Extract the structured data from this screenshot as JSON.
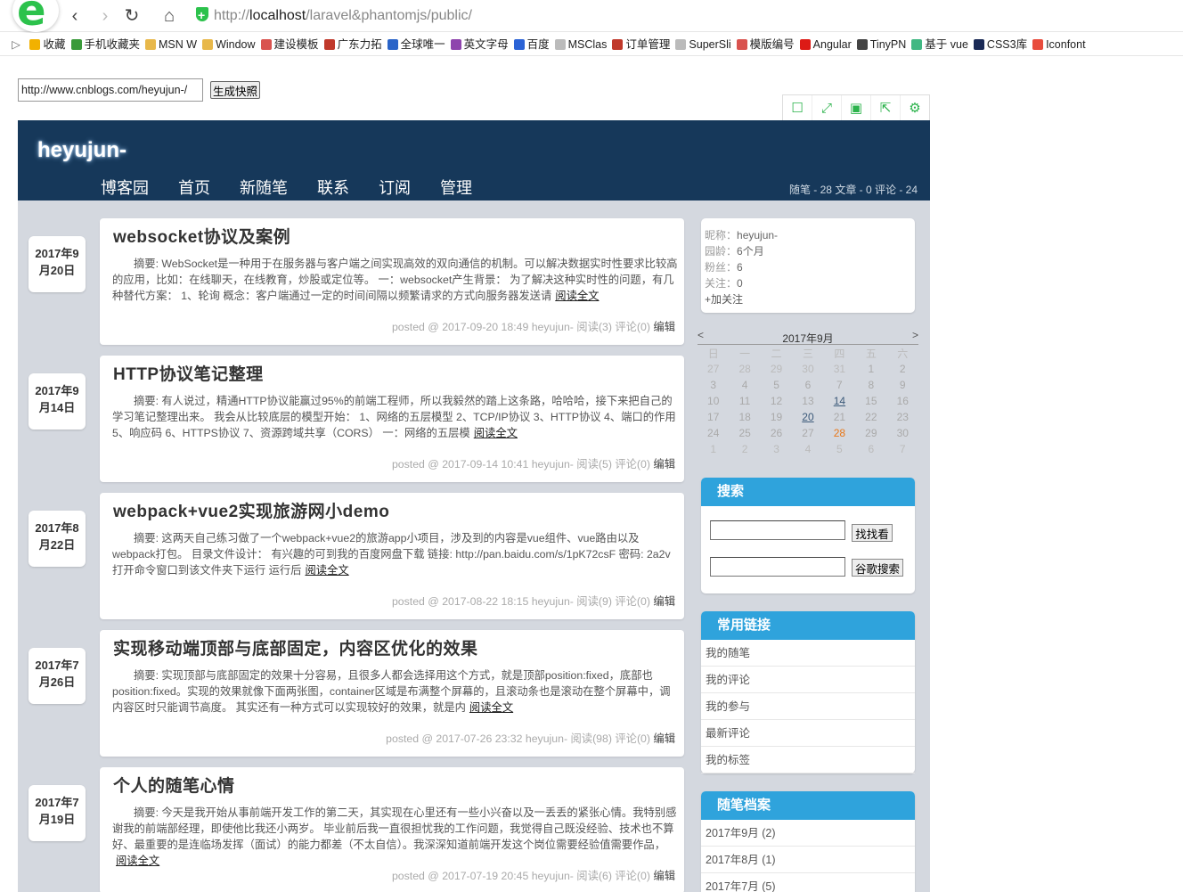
{
  "browser": {
    "brand_glyph": "e",
    "url_scheme": "http://",
    "url_host": "localhost",
    "url_path": "/laravel&phantomjs/public/",
    "favorites": [
      {
        "label": "收藏",
        "color": "#f2b100"
      },
      {
        "label": "手机收藏夹",
        "color": "#3a9a3a"
      },
      {
        "label": "MSN W",
        "color": "#e8b84a"
      },
      {
        "label": "Window",
        "color": "#e8b84a"
      },
      {
        "label": "建设模板",
        "color": "#d9534f"
      },
      {
        "label": "广东力拓",
        "color": "#c0392b"
      },
      {
        "label": "全球唯一",
        "color": "#2a64c8"
      },
      {
        "label": "英文字母",
        "color": "#8e44ad"
      },
      {
        "label": "百度",
        "color": "#2b63d6"
      },
      {
        "label": "MSClas",
        "color": "#bbbbbb"
      },
      {
        "label": "订单管理",
        "color": "#c0392b"
      },
      {
        "label": "SuperSli",
        "color": "#bbbbbb"
      },
      {
        "label": "模版编号",
        "color": "#d9534f"
      },
      {
        "label": "Angular",
        "color": "#dd1b16"
      },
      {
        "label": "TinyPN",
        "color": "#444444"
      },
      {
        "label": "基于 vue",
        "color": "#41b883"
      },
      {
        "label": "CSS3库",
        "color": "#1a2a56"
      },
      {
        "label": "Iconfont",
        "color": "#e84c3d"
      }
    ]
  },
  "snapshot": {
    "url_value": "http://www.cnblogs.com/heyujun-/",
    "button_label": "生成快照"
  },
  "blog": {
    "title": "heyujun-",
    "nav": [
      "博客园",
      "首页",
      "新随笔",
      "联系",
      "订阅",
      "管理"
    ],
    "stats": "随笔 - 28  文章 - 0  评论 - 24"
  },
  "posts": [
    {
      "date1": "2017年9",
      "date2": "月20日",
      "title": "websocket协议及案例",
      "summary": "摘要: WebSocket是一种用于在服务器与客户端之间实现高效的双向通信的机制。可以解决数据实时性要求比较高的应用，比如：在线聊天，在线教育，炒股或定位等。 一：websocket产生背景： 为了解决这种实时性的问题，有几种替代方案： 1、轮询 概念：客户端通过一定的时间间隔以频繁请求的方式向服务器发送请",
      "more": "阅读全文",
      "foot": "posted @ 2017-09-20 18:49 heyujun- 阅读(3) 评论(0) ",
      "edit": "编辑"
    },
    {
      "date1": "2017年9",
      "date2": "月14日",
      "title": "HTTP协议笔记整理",
      "summary": "摘要: 有人说过，精通HTTP协议能赢过95%的前端工程师，所以我毅然的踏上这条路，哈哈哈，接下来把自己的学习笔记整理出来。 我会从比较底层的模型开始： 1、网络的五层模型 2、TCP/IP协议 3、HTTP协议 4、端口的作用 5、响应码 6、HTTPS协议 7、资源跨域共享（CORS） 一：网络的五层模",
      "more": "阅读全文",
      "foot": "posted @ 2017-09-14 10:41 heyujun- 阅读(5) 评论(0) ",
      "edit": "编辑"
    },
    {
      "date1": "2017年8",
      "date2": "月22日",
      "title": "webpack+vue2实现旅游网小demo",
      "summary": "摘要: 这两天自己练习做了一个webpack+vue2的旅游app小项目，涉及到的内容是vue组件、vue路由以及webpack打包。 目录文件设计： 有兴趣的可到我的百度网盘下载 链接: http://pan.baidu.com/s/1pK72csF 密码: 2a2v 打开命令窗口到该文件夹下运行 运行后",
      "more": "阅读全文",
      "foot": "posted @ 2017-08-22 18:15 heyujun- 阅读(9) 评论(0) ",
      "edit": "编辑"
    },
    {
      "date1": "2017年7",
      "date2": "月26日",
      "title": "实现移动端顶部与底部固定，内容区优化的效果",
      "summary": "摘要: 实现顶部与底部固定的效果十分容易，且很多人都会选择用这个方式，就是顶部position:fixed，底部也position:fixed。实现的效果就像下面两张图，container区域是布满整个屏幕的，且滚动条也是滚动在整个屏幕中，调内容区时只能调节高度。 其实还有一种方式可以实现较好的效果，就是内",
      "more": "阅读全文",
      "foot": "posted @ 2017-07-26 23:32 heyujun- 阅读(98) 评论(0) ",
      "edit": "编辑"
    },
    {
      "date1": "2017年7",
      "date2": "月19日",
      "title": "个人的随笔心情",
      "summary": "摘要: 今天是我开始从事前端开发工作的第二天，其实现在心里还有一些小兴奋以及一丢丢的紧张心情。我特别感谢我的前端部经理，即使他比我还小两岁。 毕业前后我一直很担忧我的工作问题，我觉得自己既没经验、技术也不算好、最重要的是连临场发挥（面试）的能力都差（不太自信）。我深深知道前端开发这个岗位需要经验值需要作品，",
      "more": "阅读全文",
      "foot": "posted @ 2017-07-19 20:45 heyujun- 阅读(6) 评论(0) ",
      "edit": "编辑"
    }
  ],
  "profile": {
    "nick_label": "昵称：",
    "nick": "heyujun-",
    "age_label": "园龄：",
    "age": "6个月",
    "fans_label": "粉丝：",
    "fans": "6",
    "follow_label": "关注：",
    "follow": "0",
    "add_follow": "+加关注"
  },
  "calendar": {
    "prev": "<",
    "next": ">",
    "title": "2017年9月",
    "weekdays": [
      "日",
      "一",
      "二",
      "三",
      "四",
      "五",
      "六"
    ],
    "weeks": [
      [
        "27",
        "28",
        "29",
        "30",
        "31",
        "1",
        "2"
      ],
      [
        "3",
        "4",
        "5",
        "6",
        "7",
        "8",
        "9"
      ],
      [
        "10",
        "11",
        "12",
        "13",
        "14",
        "15",
        "16"
      ],
      [
        "17",
        "18",
        "19",
        "20",
        "21",
        "22",
        "23"
      ],
      [
        "24",
        "25",
        "26",
        "27",
        "28",
        "29",
        "30"
      ],
      [
        "1",
        "2",
        "3",
        "4",
        "5",
        "6",
        "7"
      ]
    ]
  },
  "search": {
    "title": "搜索",
    "btn_site": "找找看",
    "btn_google": "谷歌搜索"
  },
  "links": {
    "title": "常用链接",
    "items": [
      "我的随笔",
      "我的评论",
      "我的参与",
      "最新评论",
      "我的标签"
    ]
  },
  "archive": {
    "title": "随笔档案",
    "items": [
      "2017年9月 (2)",
      "2017年8月 (1)",
      "2017年7月 (5)"
    ]
  }
}
